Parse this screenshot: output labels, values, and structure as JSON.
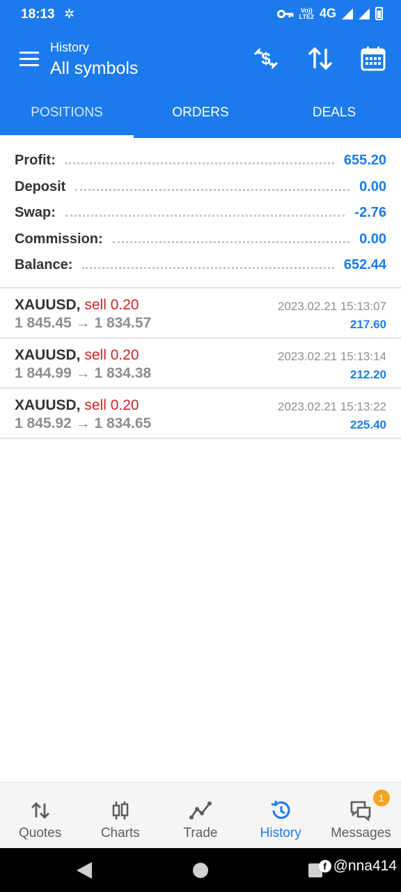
{
  "status": {
    "time": "18:13",
    "network": "4G",
    "volte_top": "Vo))",
    "volte_bottom": "LTE2"
  },
  "app_bar": {
    "subtitle": "History",
    "title": "All symbols"
  },
  "tabs": [
    {
      "label": "POSITIONS",
      "active": true
    },
    {
      "label": "ORDERS",
      "active": false
    },
    {
      "label": "DEALS",
      "active": false
    }
  ],
  "summary": [
    {
      "label": "Profit:",
      "value": "655.20"
    },
    {
      "label": "Deposit",
      "value": "0.00"
    },
    {
      "label": "Swap:",
      "value": "-2.76"
    },
    {
      "label": "Commission:",
      "value": "0.00"
    },
    {
      "label": "Balance:",
      "value": "652.44"
    }
  ],
  "deals": [
    {
      "symbol": "XAUUSD,",
      "side": "sell 0.20",
      "open": "1 845.45",
      "arrow": "→",
      "close": "1 834.57",
      "time": "2023.02.21 15:13:07",
      "profit": "217.60"
    },
    {
      "symbol": "XAUUSD,",
      "side": "sell 0.20",
      "open": "1 844.99",
      "arrow": "→",
      "close": "1 834.38",
      "time": "2023.02.21 15:13:14",
      "profit": "212.20"
    },
    {
      "symbol": "XAUUSD,",
      "side": "sell 0.20",
      "open": "1 845.92",
      "arrow": "→",
      "close": "1 834.65",
      "time": "2023.02.21 15:13:22",
      "profit": "225.40"
    }
  ],
  "bottom_nav": [
    {
      "label": "Quotes",
      "icon": "quotes-icon"
    },
    {
      "label": "Charts",
      "icon": "charts-icon"
    },
    {
      "label": "Trade",
      "icon": "trade-icon"
    },
    {
      "label": "History",
      "icon": "history-icon",
      "active": true
    },
    {
      "label": "Messages",
      "icon": "messages-icon",
      "badge": "1"
    }
  ],
  "watermark": {
    "fb": "f",
    "handle": "@nna414"
  },
  "colors": {
    "primary": "#1c7bec",
    "sell": "#c62828",
    "badge": "#f5a623"
  }
}
